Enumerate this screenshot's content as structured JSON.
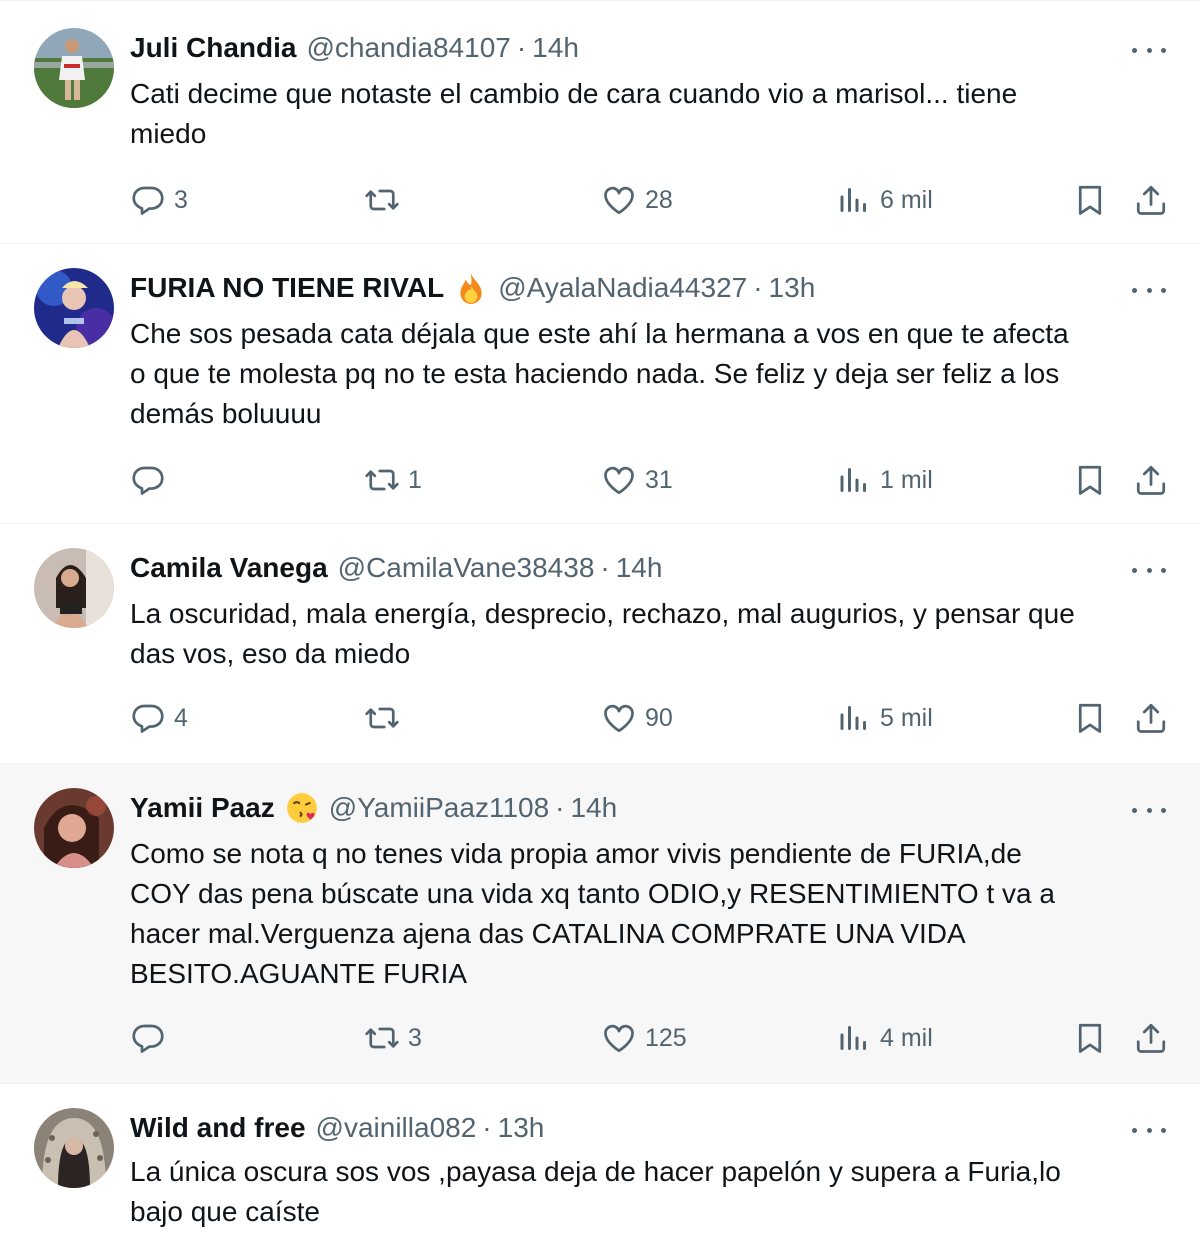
{
  "tweets": [
    {
      "name": "Juli Chandia",
      "handle": "@chandia84107",
      "sep": "·",
      "time": "14h",
      "lines": [
        "Cati decime que notaste el cambio de cara cuando vio a marisol... tiene",
        "miedo"
      ],
      "replies": "3",
      "retweets": "",
      "likes": "28",
      "views": "6 mil"
    },
    {
      "name": "FURIA NO TIENE RIVAL",
      "name_emoji": "fire-emoji",
      "handle": "@AyalaNadia44327",
      "sep": "·",
      "time": "13h",
      "lines": [
        "Che sos pesada cata déjala que este ahí la hermana a vos en que te afecta",
        "o que te molesta pq no te esta haciendo nada. Se feliz y deja ser feliz a los",
        "demás boluuuu"
      ],
      "replies": "",
      "retweets": "1",
      "likes": "31",
      "views": "1 mil"
    },
    {
      "name": "Camila Vanega",
      "handle": "@CamilaVane38438",
      "sep": "·",
      "time": "14h",
      "lines": [
        "La oscuridad, mala energía, desprecio, rechazo, mal augurios, y pensar que",
        "das vos, eso da miedo"
      ],
      "replies": "4",
      "retweets": "",
      "likes": "90",
      "views": "5 mil"
    },
    {
      "name": "Yamii Paaz",
      "name_emoji": "kissing-face-emoji",
      "handle": "@YamiiPaaz1108",
      "sep": "·",
      "time": "14h",
      "lines": [
        "Como se nota q no tenes vida propia amor vivis pendiente de FURIA,de",
        "COY das pena búscate una vida xq tanto ODIO,y RESENTIMIENTO t va a",
        "hacer mal.Verguenza ajena das CATALINA COMPRATE UNA VIDA",
        "BESITO.AGUANTE FURIA"
      ],
      "replies": "",
      "retweets": "3",
      "likes": "125",
      "views": "4 mil"
    },
    {
      "name": "Wild and free",
      "handle": "@vainilla082",
      "sep": "·",
      "time": "13h",
      "lines": [
        "La única oscura sos vos ,payasa deja de hacer papelón y supera a Furia,lo",
        "bajo que caíste"
      ]
    }
  ],
  "colors": {
    "text": "#0f1419",
    "secondary": "#536471",
    "border": "#eff3f4",
    "highlight_bg": "#f7f7f7"
  },
  "icons": {
    "reply": "reply-icon",
    "retweet": "retweet-icon",
    "like": "heart-icon",
    "views": "views-icon",
    "bookmark": "bookmark-icon",
    "share": "share-icon",
    "more": "more-options-icon"
  }
}
